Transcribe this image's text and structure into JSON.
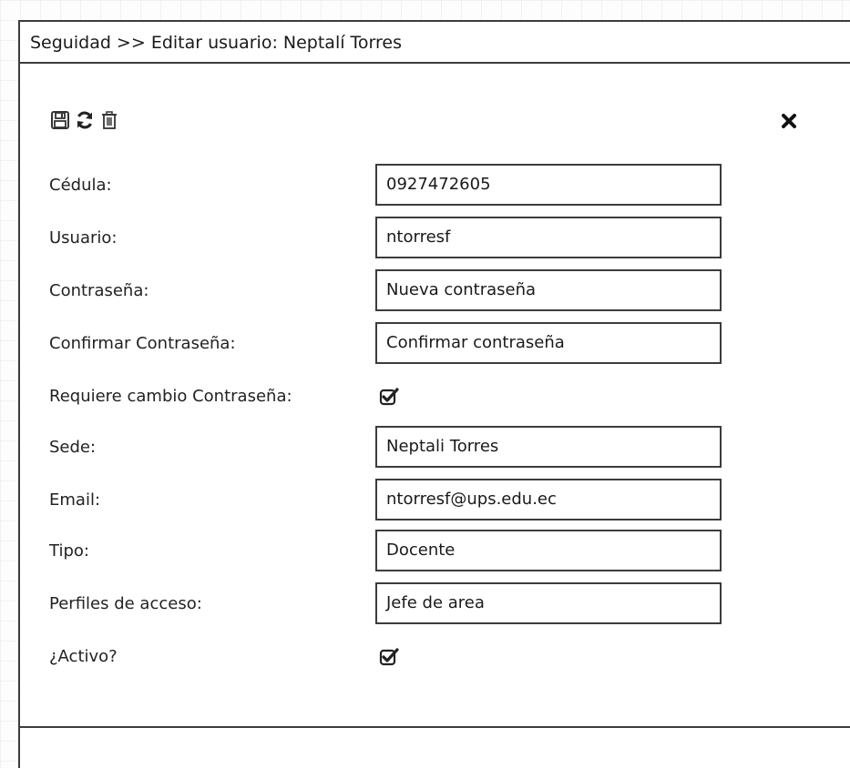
{
  "header": {
    "title": "Seguidad >> Editar usuario: Neptalí Torres"
  },
  "toolbar": {
    "icons": [
      "save-icon",
      "refresh-icon",
      "trash-icon"
    ],
    "close_icon": "close-icon"
  },
  "form": {
    "cedula": {
      "label": "Cédula:",
      "value": "0927472605"
    },
    "usuario": {
      "label": "Usuario:",
      "value": "ntorresf"
    },
    "contrasena": {
      "label": "Contraseña:",
      "value": "Nueva contraseña"
    },
    "confirmar": {
      "label": "Confirmar Contraseña:",
      "value": "Confirmar contraseña"
    },
    "requiere_cambio": {
      "label": "Requiere cambio Contraseña:",
      "checked": true
    },
    "sede": {
      "label": "Sede:",
      "value": "Neptali Torres"
    },
    "email": {
      "label": "Email:",
      "value": "ntorresf@ups.edu.ec"
    },
    "tipo": {
      "label": "Tipo:",
      "value": "Docente"
    },
    "perfiles": {
      "label": "Perfiles de acceso:",
      "value": "Jefe de area"
    },
    "activo": {
      "label": "¿Activo?",
      "checked": true
    }
  },
  "colors": {
    "border": "#3c3c3c",
    "text": "#222222",
    "background": "#ffffff"
  }
}
